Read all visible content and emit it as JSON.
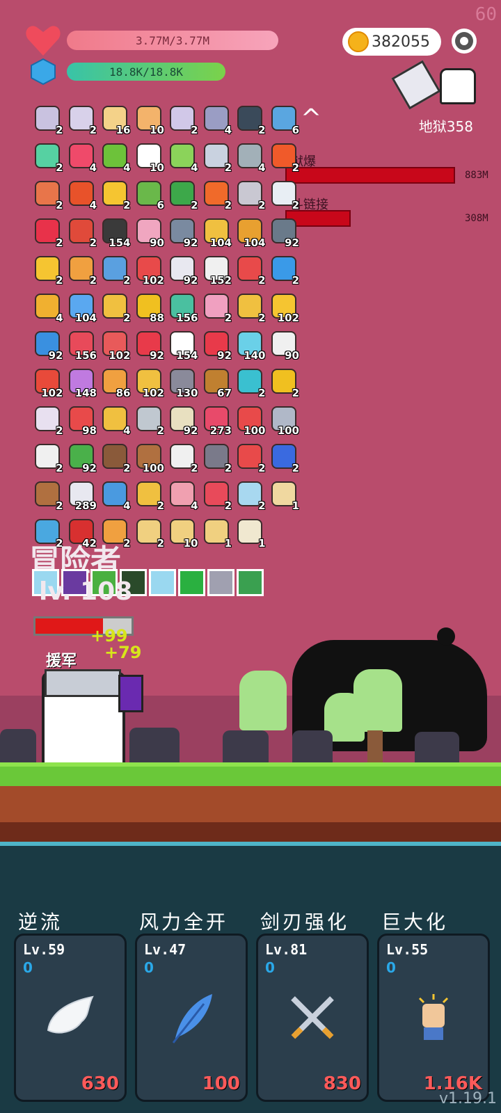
{
  "fps": "60",
  "player": {
    "hp": "3.77M/3.77M",
    "mp": "18.8K/18.8K"
  },
  "coins": "382055",
  "stage": "地狱358",
  "bosses": [
    {
      "label": "狱爆",
      "value": "883M"
    },
    {
      "label": "斗链接",
      "value": "308M"
    }
  ],
  "items": [
    {
      "count": "2",
      "color": "#c9c2e0"
    },
    {
      "count": "2",
      "color": "#d8d1ea"
    },
    {
      "count": "16",
      "color": "#f4d289"
    },
    {
      "count": "10",
      "color": "#f3b36b"
    },
    {
      "count": "2",
      "color": "#d1c8e8"
    },
    {
      "count": "4",
      "color": "#9a9dc4"
    },
    {
      "count": "2",
      "color": "#3a4a5a"
    },
    {
      "count": "6",
      "color": "#5aa6e0"
    },
    {
      "count": "2",
      "color": "#56d1a2"
    },
    {
      "count": "4",
      "color": "#ef4a6a"
    },
    {
      "count": "4",
      "color": "#6dc23a"
    },
    {
      "count": "10",
      "color": "#ffffff"
    },
    {
      "count": "4",
      "color": "#8bd35a"
    },
    {
      "count": "2",
      "color": "#c9d2e0"
    },
    {
      "count": "4",
      "color": "#a2b0b8"
    },
    {
      "count": "2",
      "color": "#f05a2a"
    },
    {
      "count": "2",
      "color": "#e8754a"
    },
    {
      "count": "4",
      "color": "#e8522a"
    },
    {
      "count": "2",
      "color": "#f5c531"
    },
    {
      "count": "6",
      "color": "#6ab84a"
    },
    {
      "count": "2",
      "color": "#3da84a"
    },
    {
      "count": "2",
      "color": "#f06a2a"
    },
    {
      "count": "2",
      "color": "#c9c8d2"
    },
    {
      "count": "2",
      "color": "#e8eef4"
    },
    {
      "count": "2",
      "color": "#e8324a"
    },
    {
      "count": "2",
      "color": "#e04a3a"
    },
    {
      "count": "154",
      "color": "#3a3a3a"
    },
    {
      "count": "90",
      "color": "#f0a6c0"
    },
    {
      "count": "92",
      "color": "#7a8aa0"
    },
    {
      "count": "104",
      "color": "#f0c040"
    },
    {
      "count": "104",
      "color": "#e8a030"
    },
    {
      "count": "92",
      "color": "#6a7a8a"
    },
    {
      "count": "2",
      "color": "#f5c531"
    },
    {
      "count": "2",
      "color": "#f0a040"
    },
    {
      "count": "2",
      "color": "#5aa0e0"
    },
    {
      "count": "102",
      "color": "#e84a4a"
    },
    {
      "count": "92",
      "color": "#e8e8f0"
    },
    {
      "count": "152",
      "color": "#f0f0f0"
    },
    {
      "count": "2",
      "color": "#e84a4a"
    },
    {
      "count": "2",
      "color": "#3a9ae8"
    },
    {
      "count": "4",
      "color": "#f0b030"
    },
    {
      "count": "104",
      "color": "#5aa8f0"
    },
    {
      "count": "2",
      "color": "#f0c040"
    },
    {
      "count": "88",
      "color": "#f0c020"
    },
    {
      "count": "156",
      "color": "#4ac0a0"
    },
    {
      "count": "2",
      "color": "#f0a0c0"
    },
    {
      "count": "2",
      "color": "#f0c040"
    },
    {
      "count": "102",
      "color": "#f5c531"
    },
    {
      "count": "92",
      "color": "#3a90e0"
    },
    {
      "count": "156",
      "color": "#e84a5a"
    },
    {
      "count": "102",
      "color": "#e85a5a"
    },
    {
      "count": "92",
      "color": "#e83a4a"
    },
    {
      "count": "154",
      "color": "#ffffff"
    },
    {
      "count": "92",
      "color": "#e83a4a"
    },
    {
      "count": "140",
      "color": "#6ad0e8"
    },
    {
      "count": "90",
      "color": "#f0f0f0"
    },
    {
      "count": "102",
      "color": "#e84a3a"
    },
    {
      "count": "148",
      "color": "#c07ae0"
    },
    {
      "count": "86",
      "color": "#f0a040"
    },
    {
      "count": "102",
      "color": "#f0c040"
    },
    {
      "count": "130",
      "color": "#8a8a9a"
    },
    {
      "count": "67",
      "color": "#c08030"
    },
    {
      "count": "2",
      "color": "#3ac0d0"
    },
    {
      "count": "2",
      "color": "#f0c020"
    },
    {
      "count": "2",
      "color": "#e8e0f0"
    },
    {
      "count": "98",
      "color": "#e84a4a"
    },
    {
      "count": "4",
      "color": "#f0c040"
    },
    {
      "count": "2",
      "color": "#c0c8d0"
    },
    {
      "count": "92",
      "color": "#e8e0c0"
    },
    {
      "count": "273",
      "color": "#e84a6a"
    },
    {
      "count": "100",
      "color": "#e84a4a"
    },
    {
      "count": "100",
      "color": "#b0b8c8"
    },
    {
      "count": "2",
      "color": "#f0f0f0"
    },
    {
      "count": "92",
      "color": "#4ab04a"
    },
    {
      "count": "2",
      "color": "#8a5a3a"
    },
    {
      "count": "100",
      "color": "#b07040"
    },
    {
      "count": "2",
      "color": "#f0f0f0"
    },
    {
      "count": "2",
      "color": "#7a7a8a"
    },
    {
      "count": "2",
      "color": "#e84a4a"
    },
    {
      "count": "2",
      "color": "#3a6ae0"
    },
    {
      "count": "2",
      "color": "#b07040"
    },
    {
      "count": "289",
      "color": "#e8e8f0"
    },
    {
      "count": "4",
      "color": "#4a9ae0"
    },
    {
      "count": "2",
      "color": "#f0c040"
    },
    {
      "count": "4",
      "color": "#f0a0b0"
    },
    {
      "count": "2",
      "color": "#e84a5a"
    },
    {
      "count": "2",
      "color": "#a8d8f0"
    },
    {
      "count": "1",
      "color": "#f0d8a0"
    },
    {
      "count": "2",
      "color": "#4aa8e0"
    },
    {
      "count": "42",
      "color": "#d83030"
    },
    {
      "count": "2",
      "color": "#f0a040"
    },
    {
      "count": "2",
      "color": "#f0d080"
    },
    {
      "count": "10",
      "color": "#f0d080"
    },
    {
      "count": "1",
      "color": "#f0d080"
    },
    {
      "count": "1",
      "color": "#f0e8d0"
    }
  ],
  "buffs": [
    "#9ad8f0",
    "#6a3aa0",
    "#4ab040",
    "#2a4a2a",
    "#9ad8f0",
    "#2ab040",
    "#a0a0b0",
    "#3aa050"
  ],
  "hero": {
    "title": "冒险者",
    "level": "lv. 108",
    "reinforcement": "援军",
    "damage": [
      "+99",
      "+79"
    ]
  },
  "skills": [
    {
      "name": "逆流",
      "level": "Lv.59",
      "value": "0",
      "cost": "630",
      "icon": "wing-icon"
    },
    {
      "name": "风力全开",
      "level": "Lv.47",
      "value": "0",
      "cost": "100",
      "icon": "feather-icon"
    },
    {
      "name": "剑刃强化",
      "level": "Lv.81",
      "value": "0",
      "cost": "830",
      "icon": "crossed-swords-icon"
    },
    {
      "name": "巨大化",
      "level": "Lv.55",
      "value": "0",
      "cost": "1.16K",
      "icon": "fist-icon"
    }
  ],
  "version": "v1.19.1"
}
